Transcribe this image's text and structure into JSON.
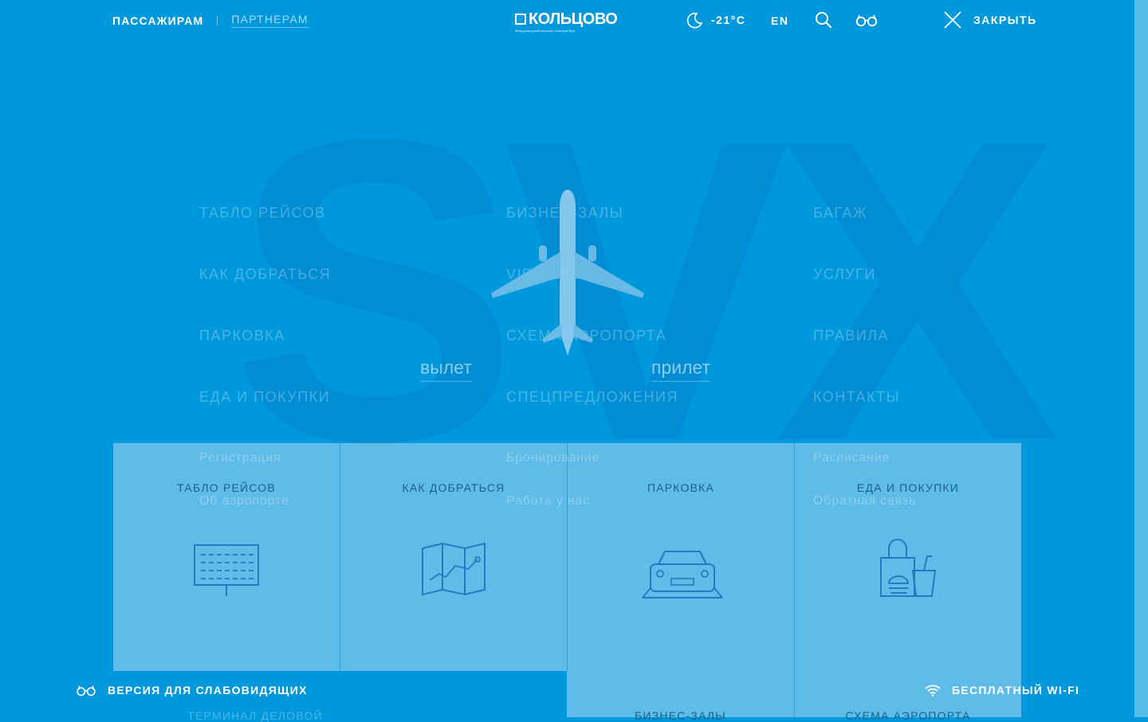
{
  "header": {
    "audience": {
      "active": "ПАССАЖИРАМ",
      "inactive": "ПАРТНЕРАМ"
    },
    "logo": {
      "text": "КОЛЬЦОВО",
      "subtitle": "Международный аэропорт Екатеринбург"
    },
    "weather": {
      "icon": "moon-icon",
      "temperature": "-21°C"
    },
    "language": "EN",
    "close_label": "ЗАКРЫТЬ"
  },
  "background_code": "SVX",
  "menu": {
    "columns": [
      [
        "ТАБЛО РЕЙСОВ",
        "КАК ДОБРАТЬСЯ",
        "ПАРКОВКА",
        "ЕДА И ПОКУПКИ"
      ],
      [
        "БИЗНЕС-ЗАЛЫ",
        "VIP СЕРВИС",
        "СХЕМА АЭРОПОРТА",
        "СПЕЦПРЕДЛОЖЕНИЯ"
      ],
      [
        "БАГАЖ",
        "УСЛУГИ",
        "ПРАВИЛА",
        "КОНТАКТЫ"
      ]
    ],
    "secondary": [
      [
        "Регистрация",
        "Об аэропорте"
      ],
      [
        "Бронирование",
        "Работа у нас"
      ],
      [
        "Расписание",
        "Обратная связь"
      ]
    ]
  },
  "flights": {
    "departure": "вылет",
    "arrival": "прилет"
  },
  "cards": [
    {
      "title": "ТАБЛО РЕЙСОВ",
      "icon": "departure-board-icon"
    },
    {
      "title": "КАК ДОБРАТЬСЯ",
      "icon": "map-icon"
    },
    {
      "title": "ПАРКОВКА",
      "icon": "car-icon"
    },
    {
      "title": "ЕДА И ПОКУПКИ",
      "icon": "shopping-food-icon"
    },
    {
      "title": "ТЕРМИНАЛ ДЕЛОВОЙ"
    },
    {
      "title": "БИЗНЕС-ЗАЛЫ"
    },
    {
      "title": "СХЕМА АЭРОПОРТА"
    }
  ],
  "footer": {
    "accessibility_label": "ВЕРСИЯ ДЛЯ СЛАБОВИДЯЩИХ",
    "wifi_label": "БЕСПЛАТНЫЙ WI-FI"
  },
  "colors": {
    "background": "#0098dc",
    "card": "#57b8e4",
    "card_text": "#1a5f88"
  }
}
